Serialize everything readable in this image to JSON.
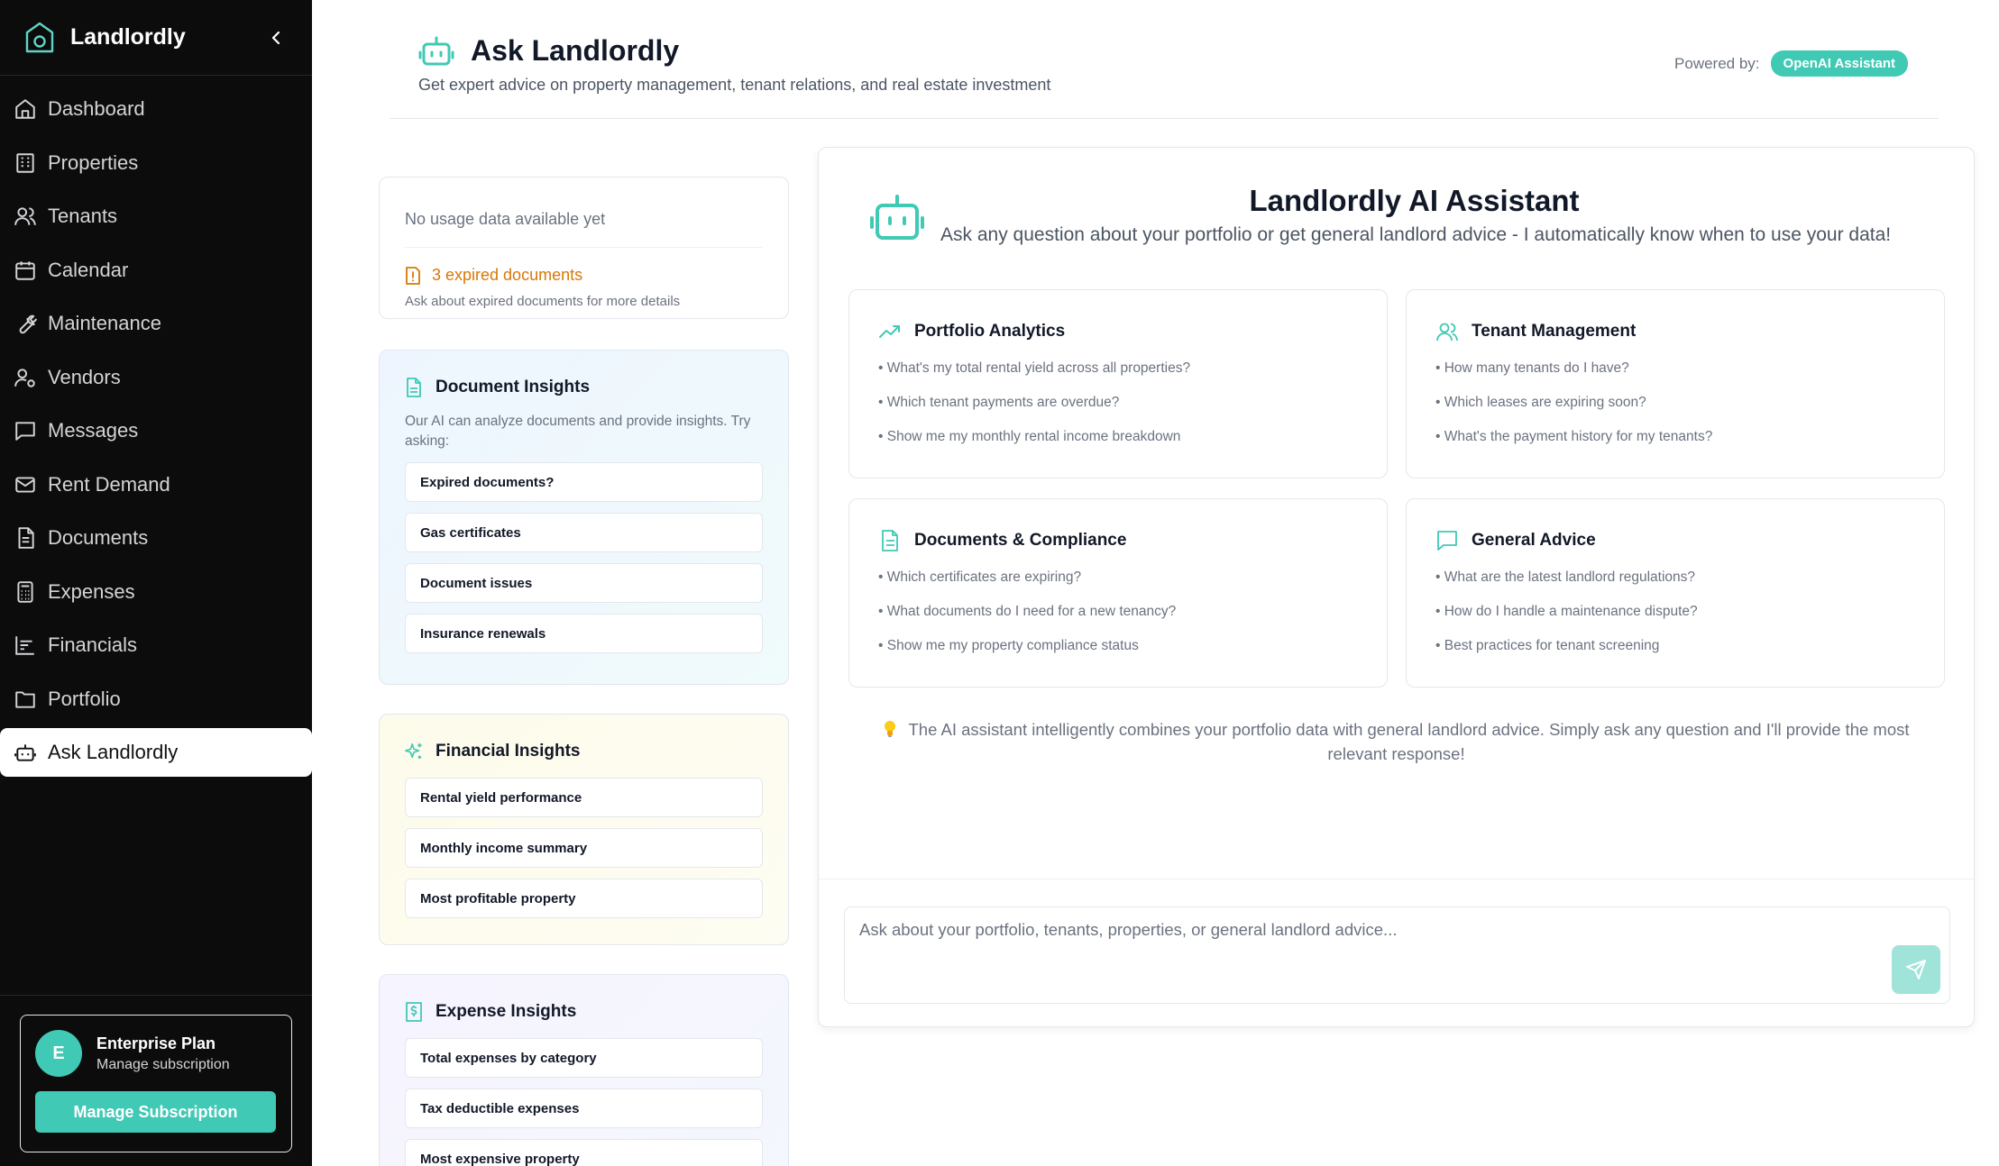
{
  "brand": {
    "name": "Landlordly"
  },
  "sidebar": {
    "items": [
      {
        "label": "Dashboard",
        "icon": "home-icon",
        "active": false
      },
      {
        "label": "Properties",
        "icon": "building-icon",
        "active": false
      },
      {
        "label": "Tenants",
        "icon": "users-icon",
        "active": false
      },
      {
        "label": "Calendar",
        "icon": "calendar-icon",
        "active": false
      },
      {
        "label": "Maintenance",
        "icon": "wrench-icon",
        "active": false
      },
      {
        "label": "Vendors",
        "icon": "user-cog-icon",
        "active": false
      },
      {
        "label": "Messages",
        "icon": "message-square-icon",
        "active": false
      },
      {
        "label": "Rent Demand",
        "icon": "mail-icon",
        "active": false
      },
      {
        "label": "Documents",
        "icon": "file-text-icon",
        "active": false
      },
      {
        "label": "Expenses",
        "icon": "calculator-icon",
        "active": false
      },
      {
        "label": "Financials",
        "icon": "bar-chart-icon",
        "active": false
      },
      {
        "label": "Portfolio",
        "icon": "folder-icon",
        "active": false
      },
      {
        "label": "Ask Landlordly",
        "icon": "bot-icon",
        "active": true
      }
    ],
    "plan": {
      "avatar_letter": "E",
      "name": "Enterprise Plan",
      "subtitle": "Manage subscription",
      "button": "Manage Subscription"
    }
  },
  "header": {
    "title": "Ask Landlordly",
    "subtitle": "Get expert advice on property management, tenant relations, and real estate investment",
    "powered_label": "Powered by:",
    "powered_badge": "OpenAI Assistant"
  },
  "usage": {
    "empty_text": "No usage data available yet",
    "expired_text": "3 expired documents",
    "expired_hint": "Ask about expired documents for more details"
  },
  "document_insights": {
    "title": "Document Insights",
    "description": "Our AI can analyze documents and provide insights. Try asking:",
    "options": [
      "Expired documents?",
      "Gas certificates",
      "Document issues",
      "Insurance renewals"
    ]
  },
  "financial_insights": {
    "title": "Financial Insights",
    "options": [
      "Rental yield performance",
      "Monthly income summary",
      "Most profitable property"
    ]
  },
  "expense_insights": {
    "title": "Expense Insights",
    "options": [
      "Total expenses by category",
      "Tax deductible expenses",
      "Most expensive property"
    ]
  },
  "chat": {
    "title": "Landlordly AI Assistant",
    "subtitle": "Ask any question about your portfolio or get general landlord advice - I automatically know when to use your data!",
    "categories": [
      {
        "title": "Portfolio Analytics",
        "icon": "trending-up-icon",
        "questions": [
          "• What's my total rental yield across all properties?",
          "• Which tenant payments are overdue?",
          "• Show me my monthly rental income breakdown"
        ]
      },
      {
        "title": "Tenant Management",
        "icon": "users-icon",
        "questions": [
          "• How many tenants do I have?",
          "• Which leases are expiring soon?",
          "• What's the payment history for my tenants?"
        ]
      },
      {
        "title": "Documents & Compliance",
        "icon": "file-text-icon",
        "questions": [
          "• Which certificates are expiring?",
          "• What documents do I need for a new tenancy?",
          "• Show me my property compliance status"
        ]
      },
      {
        "title": "General Advice",
        "icon": "message-square-icon",
        "questions": [
          "• What are the latest landlord regulations?",
          "• How do I handle a maintenance dispute?",
          "• Best practices for tenant screening"
        ]
      }
    ],
    "tip": "The AI assistant intelligently combines your portfolio data with general landlord advice. Simply ask any question and I'll provide the most relevant response!",
    "input_placeholder": "Ask about your portfolio, tenants, properties, or general landlord advice...",
    "input_value": ""
  },
  "colors": {
    "accent": "#40c9b5",
    "warning": "#d97706",
    "sidebar_bg": "#0c0c0c"
  }
}
